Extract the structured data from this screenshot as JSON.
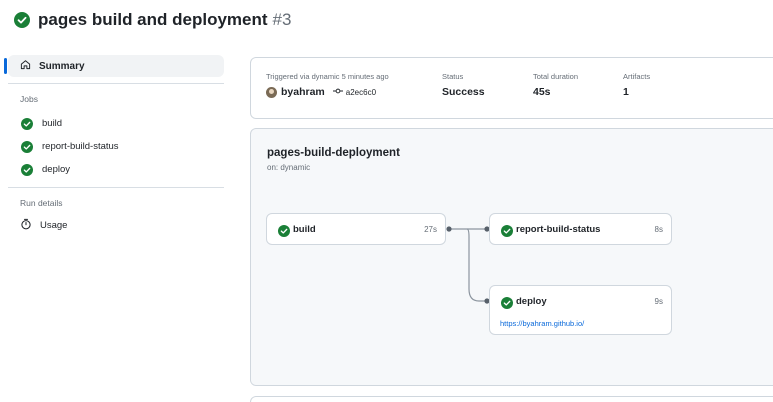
{
  "header": {
    "title": "pages build and deployment",
    "run_number": "#3"
  },
  "sidebar": {
    "summary_label": "Summary",
    "jobs_heading": "Jobs",
    "jobs": [
      {
        "label": "build"
      },
      {
        "label": "report-build-status"
      },
      {
        "label": "deploy"
      }
    ],
    "run_details_heading": "Run details",
    "usage_label": "Usage"
  },
  "summary": {
    "triggered_label": "Triggered via dynamic 5 minutes ago",
    "actor": "byahram",
    "commit": "a2ec6c0",
    "status_label": "Status",
    "status_value": "Success",
    "duration_label": "Total duration",
    "duration_value": "45s",
    "artifacts_label": "Artifacts",
    "artifacts_value": "1"
  },
  "graph": {
    "title": "pages-build-deployment",
    "subtitle": "on: dynamic",
    "nodes": [
      {
        "name": "build",
        "duration": "27s"
      },
      {
        "name": "report-build-status",
        "duration": "8s"
      },
      {
        "name": "deploy",
        "duration": "9s",
        "link": "https://byahram.github.io/"
      }
    ]
  },
  "colors": {
    "success": "#1a7f37",
    "accent": "#0969da"
  }
}
